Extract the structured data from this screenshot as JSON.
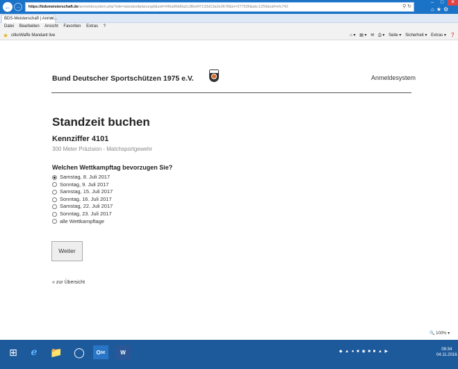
{
  "browser": {
    "url_host": "https://bdsmeisterschaft.de",
    "url_path": "/anmeldesystem.php?site=standzeitplanung0&sid=046a9fdd0a2c38ed47133d13a2e0678&m=277536&akc1259&sid=efc742",
    "tab_title": "BDS-Meisterschaft | Anmel...",
    "tab_close": "×",
    "menu": [
      "Datei",
      "Bearbeiten",
      "Ansicht",
      "Favoriten",
      "Extras",
      "?"
    ],
    "favorites": "citkoWaffe  Mandant live",
    "commandbar": [
      "Seite ▾",
      "Sicherheit ▾",
      "Extras ▾"
    ],
    "zoom": "100%"
  },
  "page": {
    "org_name": "Bund Deutscher Sportschützen 1975 e.V.",
    "system_name": "Anmeldesystem",
    "heading": "Standzeit buchen",
    "kennziffer": "Kennziffer 4101",
    "discipline": "300 Meter Präzision - Matchsportgewehr",
    "question": "Welchen Wettkampftag bevorzugen Sie?",
    "options": [
      "Samstag, 8. Juli 2017",
      "Sonntag, 9. Juli 2017",
      "Samstag, 15. Juli 2017",
      "Sonntag, 16. Juli 2017",
      "Samstag, 22. Juli 2017",
      "Sonntag, 23. Juli 2017",
      "alle Wettkampftage"
    ],
    "selected_option": 0,
    "submit_label": "Weiter",
    "back_link": "« zur Übersicht"
  },
  "taskbar": {
    "time": "08:34",
    "date": "04.11.2016"
  },
  "colors": {
    "titlebar": "#1b73c7",
    "taskbar": "#1d5a9c",
    "logo_accent": "#e2641e"
  }
}
